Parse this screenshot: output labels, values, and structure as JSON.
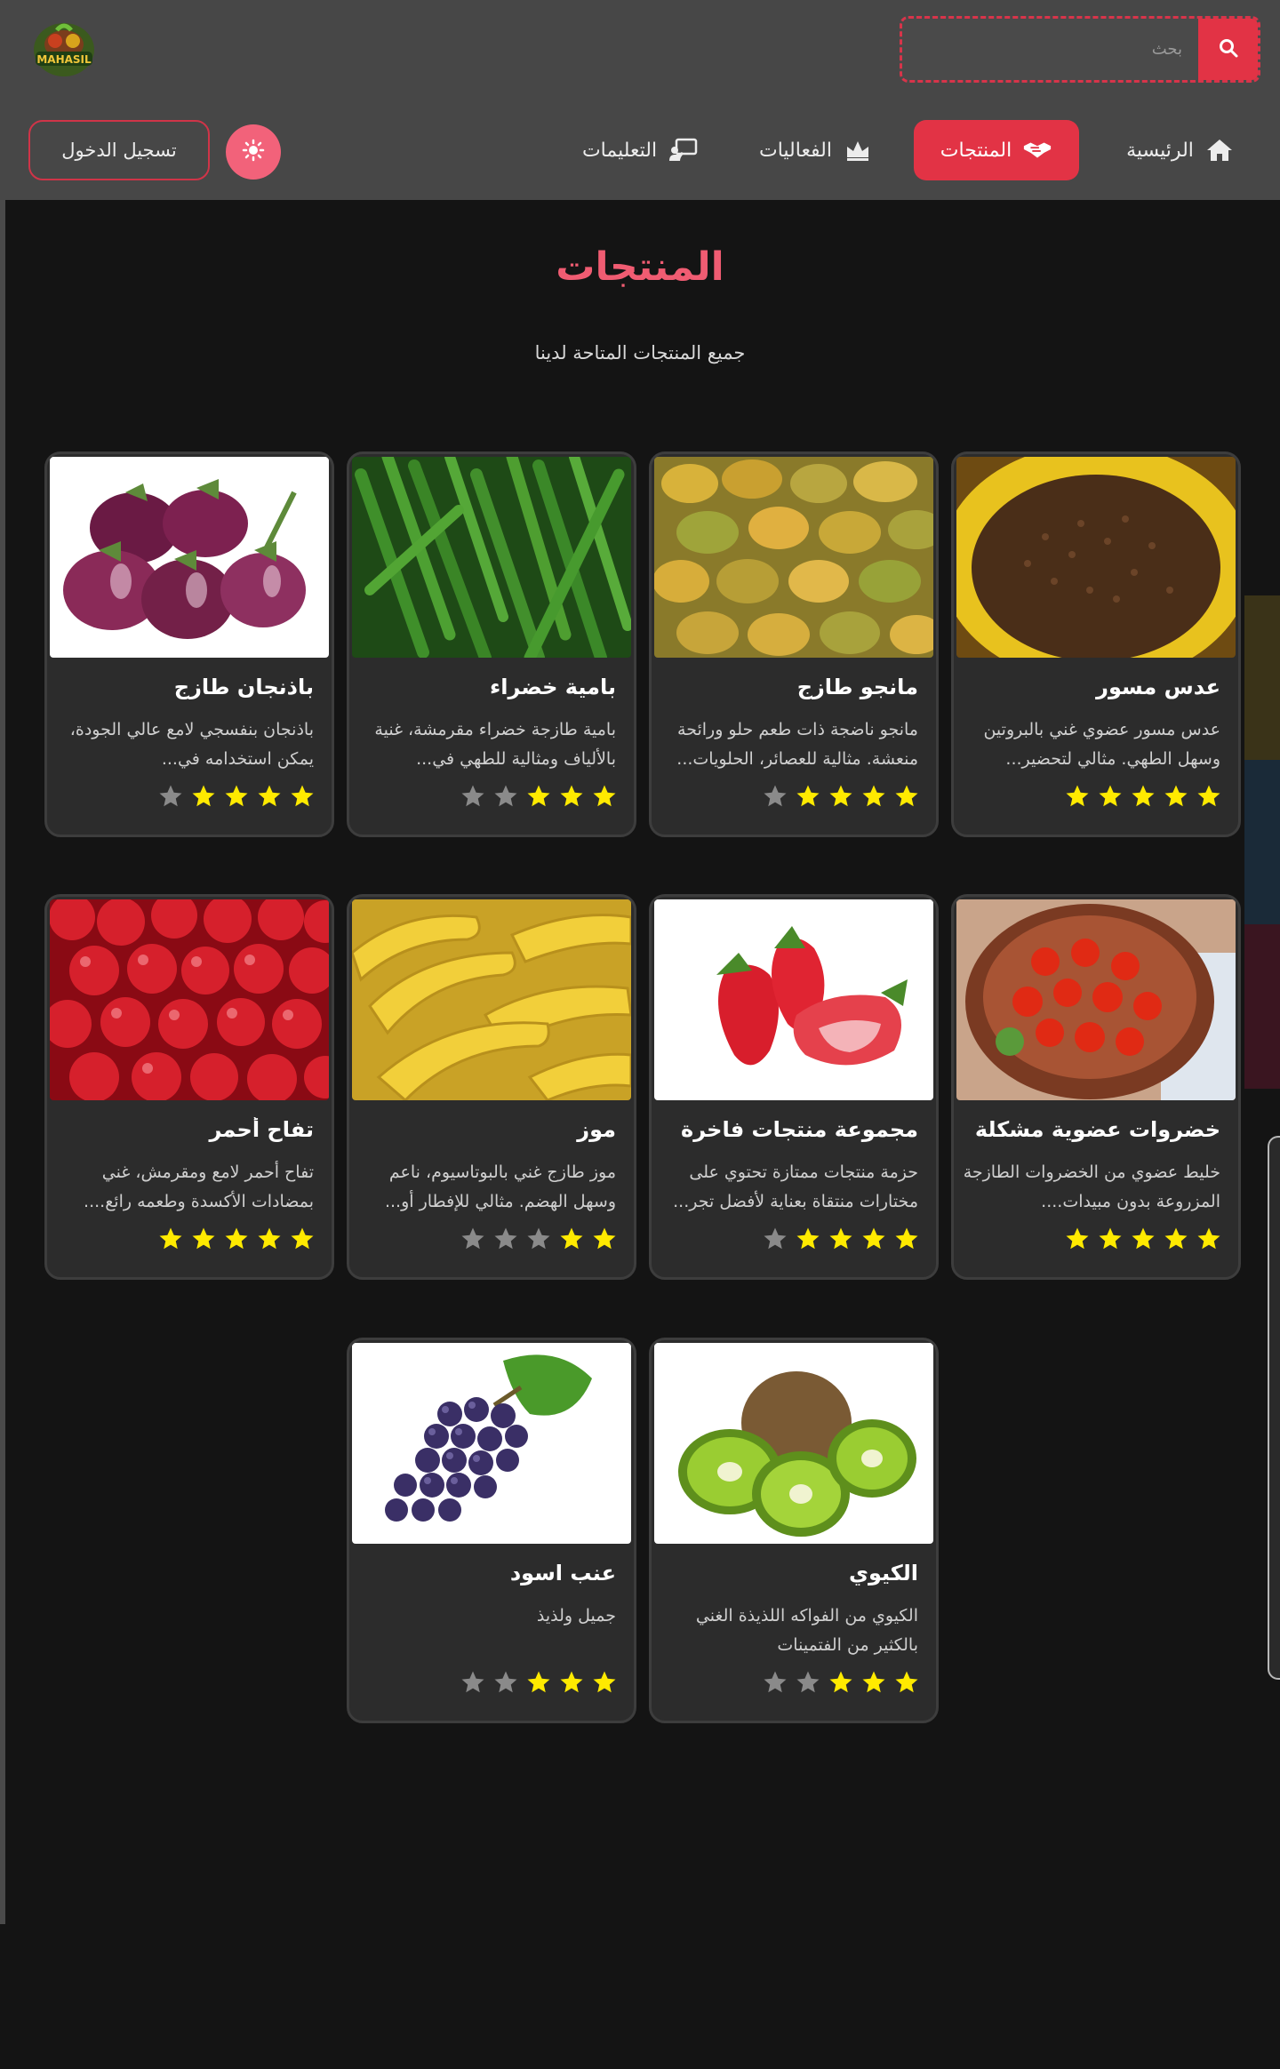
{
  "header": {
    "logo_text": "MAHASIL",
    "search": {
      "placeholder": "بحث",
      "value": ""
    },
    "icons": {
      "search": "search-icon"
    }
  },
  "nav": {
    "items": [
      {
        "label": "الرئيسية",
        "icon": "home-icon",
        "active": false
      },
      {
        "label": "المنتجات",
        "icon": "handshake-icon",
        "active": true
      },
      {
        "label": "الفعاليات",
        "icon": "crown-icon",
        "active": false
      },
      {
        "label": "التعليمات",
        "icon": "teacher-icon",
        "active": false
      }
    ],
    "theme_icon": "sun-icon",
    "login_label": "تسجيل الدخول"
  },
  "page": {
    "title": "المنتجات",
    "subtitle": "جميع المنتجات المتاحة لدينا"
  },
  "products": [
    {
      "name": "عدس مسور",
      "desc": "عدس مسور عضوي غني بالبروتين وسهل الطهي. مثالي لتحضير...",
      "rating": 5,
      "image": "lentils"
    },
    {
      "name": "مانجو طازج",
      "desc": "مانجو ناضجة ذات طعم حلو ورائحة منعشة. مثالية للعصائر، الحلويات...",
      "rating": 4,
      "image": "mangoes"
    },
    {
      "name": "بامية خضراء",
      "desc": "بامية طازجة خضراء مقرمشة، غنية بالألياف ومثالية للطهي في...",
      "rating": 3,
      "image": "okra"
    },
    {
      "name": "باذنجان طازج",
      "desc": "باذنجان بنفسجي لامع عالي الجودة، يمكن استخدامه في...",
      "rating": 4,
      "image": "eggplant"
    },
    {
      "name": "خضروات عضوية مشكلة",
      "desc": "خليط عضوي من الخضروات الطازجة المزروعة بدون مبيدات....",
      "rating": 5,
      "image": "tomatoes"
    },
    {
      "name": "مجموعة منتجات فاخرة",
      "desc": "حزمة منتجات ممتازة تحتوي على مختارات منتقاة بعناية لأفضل تجر...",
      "rating": 4,
      "image": "strawberries"
    },
    {
      "name": "موز",
      "desc": "موز طازج غني بالبوتاسيوم، ناعم وسهل الهضم. مثالي للإفطار أو...",
      "rating": 2,
      "image": "bananas"
    },
    {
      "name": "تفاح أحمر",
      "desc": "تفاح أحمر لامع ومقرمش، غني بمضادات الأكسدة وطعمه رائع....",
      "rating": 5,
      "image": "apples"
    },
    {
      "name": "الكيوي",
      "desc": "الكيوي من الفواكه اللذيذة الغني بالكثير من الفتمينات",
      "rating": 3,
      "image": "kiwi"
    },
    {
      "name": "عنب اسود",
      "desc": "جميل ولذيذ",
      "rating": 3,
      "image": "grapes"
    }
  ],
  "colors": {
    "accent": "#e23345",
    "title": "#f05c72",
    "star_on": "#ffea00",
    "star_off": "#8a8a8a",
    "card_bg": "#2c2c2c",
    "header_bg": "#474747",
    "page_bg": "#141414"
  }
}
